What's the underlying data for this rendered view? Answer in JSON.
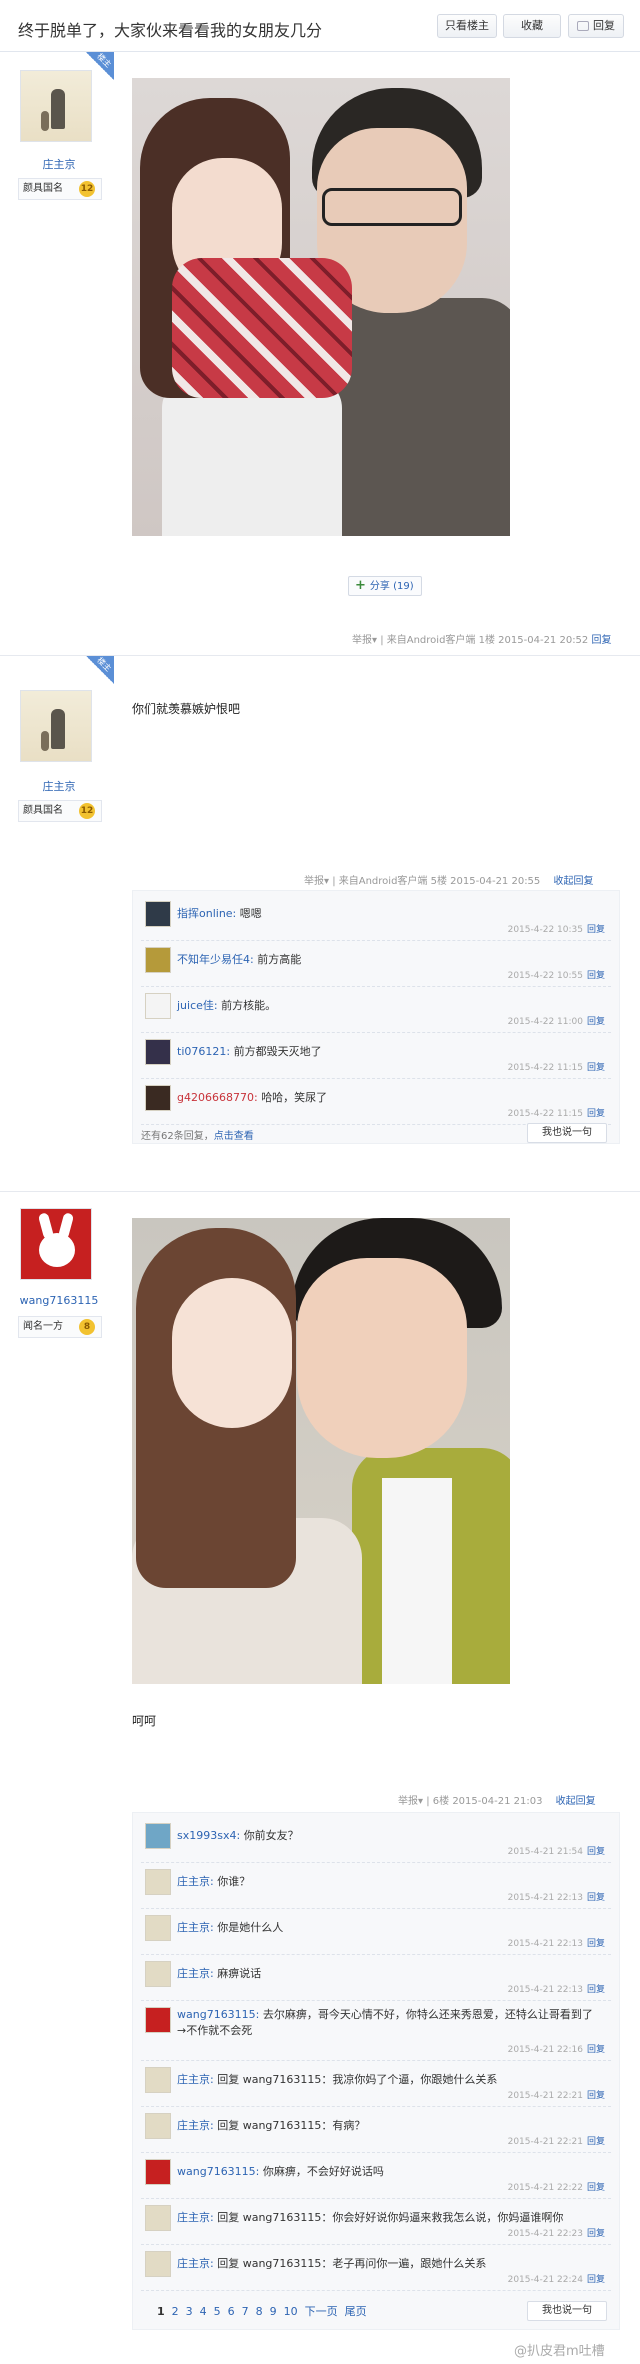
{
  "header": {
    "title": "终于脱单了，大家伙来看看我的女朋友几分",
    "only_lz_label": "只看楼主",
    "favorite_label": "收藏",
    "reply_label": "回复"
  },
  "post1": {
    "corner_label": "楼主",
    "username": "庄主京",
    "badge_title": "颜具国名",
    "badge_level": "12",
    "share_label": "分享",
    "share_count": "(19)",
    "meta": {
      "report": "举报",
      "client": "来自Android客户端",
      "floor": "1楼",
      "time": "2015-04-21 20:52",
      "reply": "回复"
    }
  },
  "post2": {
    "corner_label": "楼主",
    "username": "庄主京",
    "badge_title": "颜具国名",
    "badge_level": "12",
    "text": "你们就羡慕嫉妒恨吧",
    "meta": {
      "report": "举报",
      "client": "来自Android客户端",
      "floor": "5楼",
      "time": "2015-04-21 20:55",
      "toggle": "收起回复"
    },
    "replies": [
      {
        "name": "指挥online:",
        "text": "嗯嗯",
        "time": "2015-4-22 10:35",
        "reply": "回复"
      },
      {
        "name": "不知年少易任4:",
        "text": "前方高能",
        "time": "2015-4-22 10:55",
        "reply": "回复"
      },
      {
        "name": "juice佳:",
        "text": "前方核能。",
        "time": "2015-4-22 11:00",
        "reply": "回复"
      },
      {
        "name": "ti076121:",
        "text": "前方都毁天灭地了",
        "time": "2015-4-22 11:15",
        "reply": "回复"
      },
      {
        "name": "g4206668770:",
        "text": "哈哈，笑尿了",
        "time": "2015-4-22 11:15",
        "reply": "回复"
      }
    ],
    "more_text": "还有62条回复，",
    "more_link": "点击查看",
    "say_label": "我也说一句"
  },
  "post3": {
    "username": "wang7163115",
    "badge_title": "闻名一方",
    "badge_level": "8",
    "text": "呵呵",
    "meta": {
      "report": "举报",
      "client": "",
      "floor": "6楼",
      "time": "2015-04-21 21:03",
      "toggle": "收起回复"
    },
    "replies": [
      {
        "name": "sx1993sx4:",
        "text": "你前女友？",
        "time": "2015-4-21 21:54",
        "reply": "回复"
      },
      {
        "name": "庄主京:",
        "text": "你谁？",
        "time": "2015-4-21 22:13",
        "reply": "回复"
      },
      {
        "name": "庄主京:",
        "text": "你是她什么人",
        "time": "2015-4-21 22:13",
        "reply": "回复"
      },
      {
        "name": "庄主京:",
        "text": "麻痹说话",
        "time": "2015-4-21 22:13",
        "reply": "回复"
      },
      {
        "name": "wang7163115:",
        "text": "去尔麻痹，哥今天心情不好，你特么还来秀恩爱，还特么让哥看到了→不作就不会死",
        "time": "2015-4-21 22:16",
        "reply": "回复"
      },
      {
        "name": "庄主京:",
        "text": "回复 wang7163115：我凉你妈了个逼，你跟她什么关系",
        "time": "2015-4-21 22:21",
        "reply": "回复"
      },
      {
        "name": "庄主京:",
        "text": "回复 wang7163115：有病？",
        "time": "2015-4-21 22:21",
        "reply": "回复"
      },
      {
        "name": "wang7163115:",
        "text": "你麻痹，不会好好说话吗",
        "time": "2015-4-21 22:22",
        "reply": "回复"
      },
      {
        "name": "庄主京:",
        "text": "回复 wang7163115：你会好好说你妈逼来救我怎么说，你妈逼谁啊你",
        "time": "2015-4-21 22:23",
        "reply": "回复"
      },
      {
        "name": "庄主京:",
        "text": "回复 wang7163115：老子再问你一遍，跟她什么关系",
        "time": "2015-4-21 22:24",
        "reply": "回复"
      }
    ],
    "pager": [
      "1",
      "2",
      "3",
      "4",
      "5",
      "6",
      "7",
      "8",
      "9",
      "10",
      "下一页",
      "尾页"
    ],
    "say_label": "我也说一句"
  },
  "watermark": "@扒皮君m吐槽"
}
